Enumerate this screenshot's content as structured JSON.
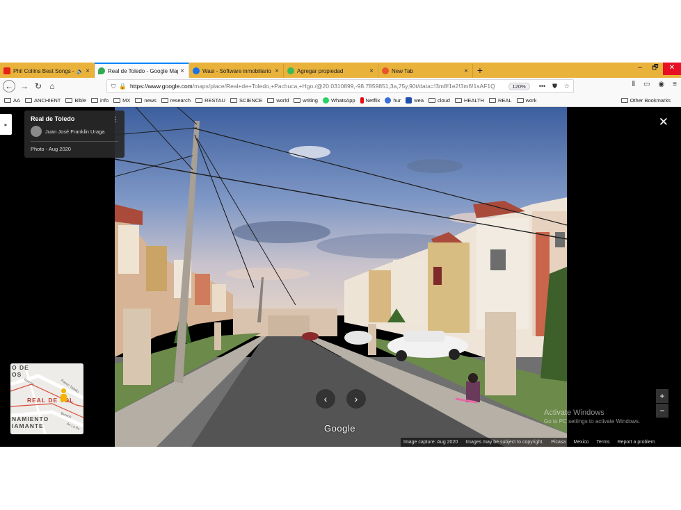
{
  "browser": {
    "tabs": [
      {
        "label": "Phil Collins Best Songs - Ph",
        "favicon_color": "#e62117",
        "sound": true
      },
      {
        "label": "Real de Toledo - Google Maps",
        "favicon_color": "#34a853",
        "active": true
      },
      {
        "label": "Wasi - Software inmobiliario",
        "favicon_color": "#1a73e8"
      },
      {
        "label": "Agregar propiedad",
        "favicon_color": "#3cba54"
      },
      {
        "label": "New Tab",
        "favicon_color": "#e8552a"
      }
    ],
    "new_tab_label": "+",
    "close_label": "×",
    "window_controls": {
      "minimize": "–",
      "restore": "🗗",
      "close": "✕"
    },
    "url_host": "https://www.google.com",
    "url_path": "/maps/place/Real+de+Toledo,+Pachuca,+Hgo./@20.0310899,-98.7859851,3a,75y,90t/data=!3m8!1e2!3m6!1sAF1Q",
    "zoom": "120%",
    "bookmarks": [
      "AA",
      "ANCHIENT",
      "Bible",
      "info",
      "MX",
      "news",
      "research",
      "RESTAU",
      "SCIENCE",
      "world",
      "writing",
      "WhatsApp",
      "Netflix",
      "hur",
      "wea",
      "cloud",
      "HEALTH",
      "REAL",
      "work"
    ],
    "other_bookmarks": "Other Bookmarks"
  },
  "viewer": {
    "place_name": "Real de Toledo",
    "author": "Juan José Franklin Uraga",
    "photo_date": "Photo - Aug 2020",
    "google_label": "Google",
    "minimap": {
      "main_label": "REAL DE TOL",
      "label_top": "O DE",
      "label_top2": "OS",
      "label_bottom": "NAMIENTO",
      "label_bottom2": "IAMANTE",
      "road1": "Toremo",
      "road2": "Paseo Toledo",
      "road3": "Bureos",
      "road4": "Av La Ps"
    },
    "activate_title": "Activate Windows",
    "activate_sub": "Go to PC settings to activate Windows.",
    "footer": [
      "Image capture: Aug 2020",
      "Images may be subject to copyright.",
      "Picasa",
      "Mexico",
      "Terms",
      "Report a problem"
    ]
  },
  "colors": {
    "tab_strip": "#e9b23b",
    "active_tab_border": "#0a84ff",
    "map_accent": "#c0392b"
  }
}
